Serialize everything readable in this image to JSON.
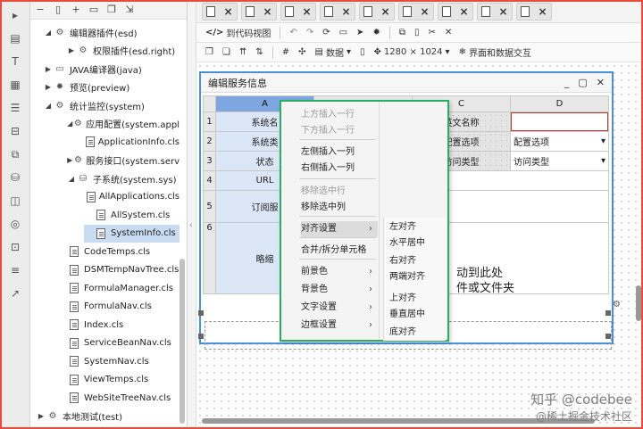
{
  "tree": {
    "items": [
      {
        "label": "编辑器插件(esd)",
        "indent": 14,
        "arrow": "▲",
        "icon": "gear-icon",
        "selected": false
      },
      {
        "label": "权限插件(esd.right)",
        "indent": 40,
        "arrow": "▶",
        "icon": "gear-icon",
        "selected": false
      },
      {
        "label": "JAVA编译器(java)",
        "indent": 14,
        "arrow": "▶",
        "icon": "window-icon",
        "selected": false
      },
      {
        "label": "预览(preview)",
        "indent": 14,
        "arrow": "▶",
        "icon": "bug-icon",
        "selected": false
      },
      {
        "label": "统计监控(system)",
        "indent": 14,
        "arrow": "▲",
        "icon": "gear-icon",
        "selected": false
      },
      {
        "label": "应用配置(system.appl",
        "indent": 40,
        "arrow": "▲",
        "icon": "gears-icon",
        "selected": false
      },
      {
        "label": "ApplicationInfo.cls",
        "indent": 60,
        "arrow": "",
        "icon": "file-icon",
        "selected": false
      },
      {
        "label": "服务接口(system.serv",
        "indent": 40,
        "arrow": "▶",
        "icon": "gears-icon",
        "selected": false
      },
      {
        "label": "子系统(system.sys)",
        "indent": 40,
        "arrow": "▲",
        "icon": "database-icon",
        "selected": false
      },
      {
        "label": "AllApplications.cls",
        "indent": 60,
        "arrow": "",
        "icon": "file-icon",
        "selected": false
      },
      {
        "label": "AllSystem.cls",
        "indent": 60,
        "arrow": "",
        "icon": "file-icon",
        "selected": false
      },
      {
        "label": "SystemInfo.cls",
        "indent": 60,
        "arrow": "",
        "icon": "file-icon",
        "selected": true
      },
      {
        "label": "CodeTemps.cls",
        "indent": 30,
        "arrow": "",
        "icon": "file-icon",
        "selected": false
      },
      {
        "label": "DSMTempNavTree.cls",
        "indent": 30,
        "arrow": "",
        "icon": "file-icon",
        "selected": false
      },
      {
        "label": "FormulaManager.cls",
        "indent": 30,
        "arrow": "",
        "icon": "file-icon",
        "selected": false
      },
      {
        "label": "FormulaNav.cls",
        "indent": 30,
        "arrow": "",
        "icon": "file-icon",
        "selected": false
      },
      {
        "label": "Index.cls",
        "indent": 30,
        "arrow": "",
        "icon": "file-icon",
        "selected": false
      },
      {
        "label": "ServiceBeanNav.cls",
        "indent": 30,
        "arrow": "",
        "icon": "file-icon",
        "selected": false
      },
      {
        "label": "SystemNav.cls",
        "indent": 30,
        "arrow": "",
        "icon": "file-icon",
        "selected": false
      },
      {
        "label": "ViewTemps.cls",
        "indent": 30,
        "arrow": "",
        "icon": "file-icon",
        "selected": false
      },
      {
        "label": "WebSiteTreeNav.cls",
        "indent": 30,
        "arrow": "",
        "icon": "file-icon",
        "selected": false
      },
      {
        "label": "本地测试(test)",
        "indent": 6,
        "arrow": "▶",
        "icon": "gear-icon",
        "selected": false
      }
    ]
  },
  "toolbar1": {
    "code_view": "到代码视图"
  },
  "toolbar2": {
    "data": "数据",
    "resolution": "1280 × 1024",
    "interaction": "界面和数据交互"
  },
  "window": {
    "title": "编辑服务信息"
  },
  "grid": {
    "columns": [
      "A",
      "B",
      "C",
      "D"
    ],
    "rows": [
      {
        "num": "1",
        "a": "系统名",
        "c": "英文名称",
        "d": ""
      },
      {
        "num": "2",
        "a": "系统类",
        "c": "配置选项",
        "d": "配置选项"
      },
      {
        "num": "3",
        "a": "状态",
        "c": "访问类型",
        "d": "访问类型"
      },
      {
        "num": "4",
        "a": "URL"
      },
      {
        "num": "5",
        "a": "订阅服"
      },
      {
        "num": "6",
        "a": "略缩"
      }
    ]
  },
  "drop_hint": {
    "line1": "动到此处",
    "line2": "件或文件夹"
  },
  "context_menu": {
    "items": [
      {
        "label": "上方插入一行",
        "disabled": true,
        "submenu": false,
        "highlight": false
      },
      {
        "label": "下方插入一行",
        "disabled": true,
        "submenu": false,
        "highlight": false
      },
      {
        "label": "左侧插入一列",
        "disabled": false,
        "submenu": false,
        "highlight": false
      },
      {
        "label": "右侧插入一列",
        "disabled": false,
        "submenu": false,
        "highlight": false
      },
      {
        "label": "移除选中行",
        "disabled": true,
        "submenu": false,
        "highlight": false
      },
      {
        "label": "移除选中列",
        "disabled": false,
        "submenu": false,
        "highlight": false
      },
      {
        "label": "对齐设置",
        "disabled": false,
        "submenu": true,
        "highlight": true
      },
      {
        "label": "合并/拆分单元格",
        "disabled": false,
        "submenu": false,
        "highlight": false
      },
      {
        "label": "前景色",
        "disabled": false,
        "submenu": true,
        "highlight": false
      },
      {
        "label": "背景色",
        "disabled": false,
        "submenu": true,
        "highlight": false
      },
      {
        "label": "文字设置",
        "disabled": false,
        "submenu": true,
        "highlight": false
      },
      {
        "label": "边框设置",
        "disabled": false,
        "submenu": true,
        "highlight": false
      }
    ],
    "submenu": [
      "左对齐",
      "水平居中",
      "右对齐",
      "两端对齐",
      "上对齐",
      "垂直居中",
      "底对齐"
    ]
  },
  "watermark": {
    "line1": "知乎 @codebee",
    "line2": "@稀土掘金技术社区"
  },
  "colors": {
    "frame_outline": "#e74c3c",
    "menu_outline": "#27ae60",
    "window_border": "#4a90d9",
    "selected_column": "#7ea6e0"
  }
}
